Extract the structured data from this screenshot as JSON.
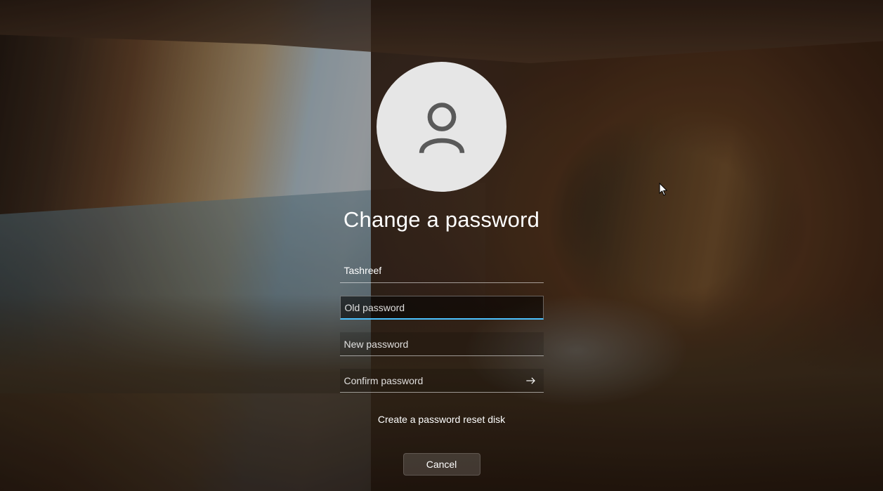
{
  "title": "Change a password",
  "username": "Tashreef",
  "fields": {
    "old_password": {
      "value": "",
      "placeholder": "Old password"
    },
    "new_password": {
      "value": "",
      "placeholder": "New password"
    },
    "confirm_password": {
      "value": "",
      "placeholder": "Confirm password"
    }
  },
  "link": {
    "reset_disk": "Create a password reset disk"
  },
  "buttons": {
    "cancel": "Cancel"
  }
}
